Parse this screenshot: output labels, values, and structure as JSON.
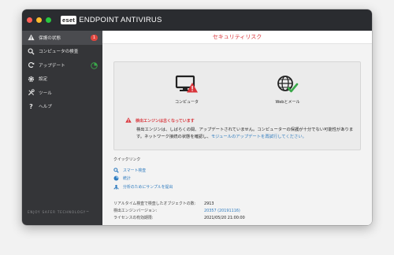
{
  "app": {
    "brand_logo": "eset",
    "title": "ENDPOINT ANTIVIRUS"
  },
  "sidebar": {
    "items": [
      {
        "label": "保護の状態",
        "icon": "warning-icon",
        "badge": "1"
      },
      {
        "label": "コンピュータの検査",
        "icon": "search-icon"
      },
      {
        "label": "アップデート",
        "icon": "refresh-icon"
      },
      {
        "label": "設定",
        "icon": "gear-icon"
      },
      {
        "label": "ツール",
        "icon": "tools-icon"
      },
      {
        "label": "ヘルプ",
        "icon": "help-icon"
      }
    ],
    "footer": "ENJOY SAFER TECHNOLOGY™"
  },
  "main": {
    "header": "セキュリティリスク",
    "status": {
      "computer_label": "コンピュータ",
      "web_label": "Webとメール",
      "warning_title": "検出エンジンは古くなっています",
      "warning_text": "検出エンジンは、しばらくの間、アップデートされていません。コンピューターの保護が十分でない可能性があります。ネットワーク接続の状態を確認し、",
      "warning_link": "モジュールのアップデートを再試行してください。"
    },
    "quick_links": {
      "title": "クイックリンク",
      "items": [
        {
          "label": "スマート検査",
          "icon": "search-icon"
        },
        {
          "label": "統計",
          "icon": "pie-chart-icon"
        },
        {
          "label": "分析のためにサンプルを提出",
          "icon": "submit-sample-icon"
        }
      ]
    },
    "stats": [
      {
        "label": "リアルタイム検査で検査したオブジェクトの数:",
        "value": "2913"
      },
      {
        "label": "検出エンジンバージョン:",
        "value": "20357 (20191116)"
      },
      {
        "label": "ライセンスの有効期限:",
        "value": "2021/05/20 21:00:00"
      }
    ]
  },
  "colors": {
    "sidebar_bg": "#343538",
    "titlebar_bg": "#2a2c30",
    "alert_red": "#d9343a",
    "link_blue": "#2e7bbf",
    "ok_green": "#3aa84a"
  }
}
